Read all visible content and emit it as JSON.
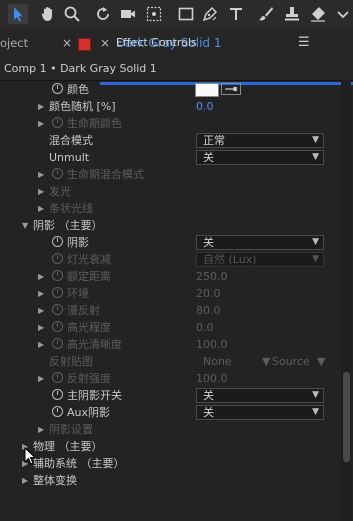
{
  "colors": {
    "accent": "#2d6ad9",
    "link_blue": "#4f8fe6",
    "layer_swatch": "#d7322a"
  },
  "toolbar": {
    "tools": [
      "selection-tool",
      "hand-tool",
      "zoom-tool",
      "rotation-tool",
      "camera-tool",
      "pan-behind-tool",
      "rectangle-tool",
      "pen-tool",
      "type-tool",
      "brush-tool",
      "clone-stamp-tool",
      "eraser-tool"
    ]
  },
  "tabs": {
    "project_label": "oject",
    "effect_controls_label": "Effect Controls",
    "layer_name": "Dark Gray Solid 1",
    "close_glyph": "×",
    "menu_glyph": "☰"
  },
  "breadcrumb": "Comp 1 • Dark Gray Solid 1",
  "rows": [
    {
      "label": "颜色"
    },
    {
      "label": "颜色随机 [%]",
      "value": "0.0"
    },
    {
      "label": "生命期颜色"
    },
    {
      "label": "混合模式",
      "value": "正常"
    },
    {
      "label": "Unmult",
      "value": "关"
    },
    {
      "label": "生命期混合模式"
    },
    {
      "label": "发光"
    },
    {
      "label": "条状光线"
    },
    {
      "label": "阴影 （主要）"
    },
    {
      "label": "阴影",
      "value": "关"
    },
    {
      "label": "灯光衰减",
      "value": "自然 (Lux)"
    },
    {
      "label": "额定距离",
      "value": "250.0"
    },
    {
      "label": "环境",
      "value": "20.0"
    },
    {
      "label": "漫反射",
      "value": "80.0"
    },
    {
      "label": "高光程度",
      "value": "0.0"
    },
    {
      "label": "高光清晰度",
      "value": "100.0"
    },
    {
      "label": "反射贴图",
      "value": "None",
      "value2": "Source"
    },
    {
      "label": "反射强度",
      "value": "100.0"
    },
    {
      "label": "主阴影开关",
      "value": "关"
    },
    {
      "label": "Aux阴影",
      "value": "关"
    },
    {
      "label": "阴影设置"
    },
    {
      "label": "物理 （主要）"
    },
    {
      "label": "辅助系统 （主要）"
    },
    {
      "label": "整体变换"
    }
  ]
}
